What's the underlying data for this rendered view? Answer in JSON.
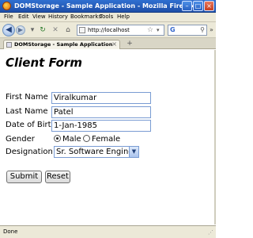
{
  "window": {
    "title": "DOMStorage - Sample Application - Mozilla Firefox"
  },
  "menu": [
    "File",
    "Edit",
    "View",
    "History",
    "Bookmarks",
    "Tools",
    "Help"
  ],
  "nav": {
    "url": "http://localhost",
    "search_engine_glyph": "G"
  },
  "tab": {
    "label": "DOMStorage - Sample Application"
  },
  "form": {
    "title": "Client Form",
    "first_name_label": "First Name",
    "first_name_value": "Viralkumar",
    "last_name_label": "Last Name",
    "last_name_value": "Patel",
    "dob_label": "Date of Birth",
    "dob_value": "1-Jan-1985",
    "gender_label": "Gender",
    "gender_options": [
      "Male",
      "Female"
    ],
    "gender_selected": "Male",
    "designation_label": "Designation",
    "designation_value": "Sr. Software Engineer",
    "submit_label": "Submit",
    "reset_label": "Reset"
  },
  "status": {
    "text": "Done"
  }
}
